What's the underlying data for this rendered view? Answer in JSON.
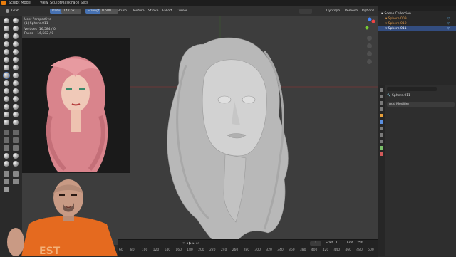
{
  "menubar": {
    "items": [
      "Sculpt Mode",
      "View",
      "Sculpt",
      "Mask",
      "Face Sets"
    ]
  },
  "tool_header": {
    "brush_name": "Grab",
    "radius_label": "Radius",
    "radius_value": "142 px",
    "strength_label": "Strength",
    "strength_value": "0.500",
    "menus": [
      "Brush",
      "Texture",
      "Stroke",
      "Falloff",
      "Cursor"
    ],
    "right_items": [
      "Dyntopo",
      "Remesh",
      "Options"
    ]
  },
  "viewport_overlay": {
    "perspective": "User Perspective",
    "object": "(1) Sphere.011",
    "vertices_label": "Vertices",
    "vertices_value": "16,584 / 0",
    "faces_label": "Faces",
    "faces_value": "16,582 / 0"
  },
  "outliner": {
    "title": "Scene Collection",
    "items": [
      "Sphere.009",
      "Sphere.010",
      "Sphere.011"
    ],
    "selected_index": 2
  },
  "properties": {
    "object_name": "Sphere.011",
    "add_modifier": "Add Modifier"
  },
  "timeline": {
    "ticks": [
      "60",
      "80",
      "100",
      "120",
      "140",
      "160",
      "180",
      "200",
      "220",
      "240",
      "260",
      "280",
      "300",
      "320",
      "340",
      "360",
      "380",
      "400",
      "420",
      "440",
      "460",
      "480",
      "500"
    ],
    "frame_current": "1",
    "start_label": "Start",
    "start_value": "1",
    "end_label": "End",
    "end_value": "250"
  },
  "colors": {
    "accent": "#4772b3",
    "viewport_bg": "#3d3d3d",
    "panel_bg": "#2b2b2b",
    "clay": "#cfcfcf",
    "hair_pink": "#d9848c"
  }
}
